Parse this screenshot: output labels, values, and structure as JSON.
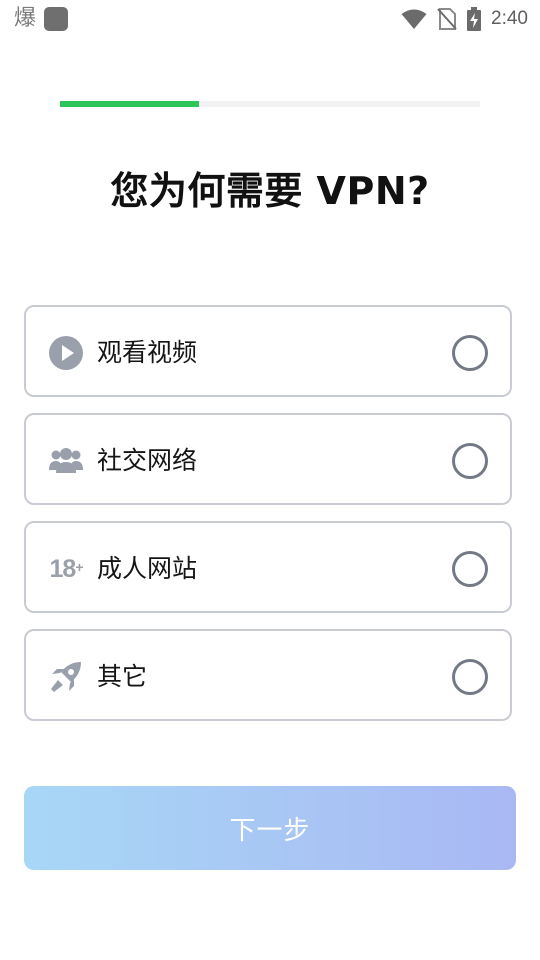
{
  "status_bar": {
    "app_glyph": "爆",
    "time": "2:40",
    "icons": [
      "wifi-icon",
      "no-sim-icon",
      "battery-charging-icon"
    ]
  },
  "progress": {
    "value": 0.33,
    "color": "#2dc458"
  },
  "title": "您为何需要 VPN?",
  "options": [
    {
      "label": "观看视频",
      "icon": "play-icon",
      "selected": false
    },
    {
      "label": "社交网络",
      "icon": "people-icon",
      "selected": false
    },
    {
      "label": "成人网站",
      "icon": "18-plus-icon",
      "icon_text": "18",
      "icon_sup": "+",
      "selected": false
    },
    {
      "label": "其它",
      "icon": "rocket-icon",
      "selected": false
    }
  ],
  "next_button": {
    "label": "下一步"
  }
}
